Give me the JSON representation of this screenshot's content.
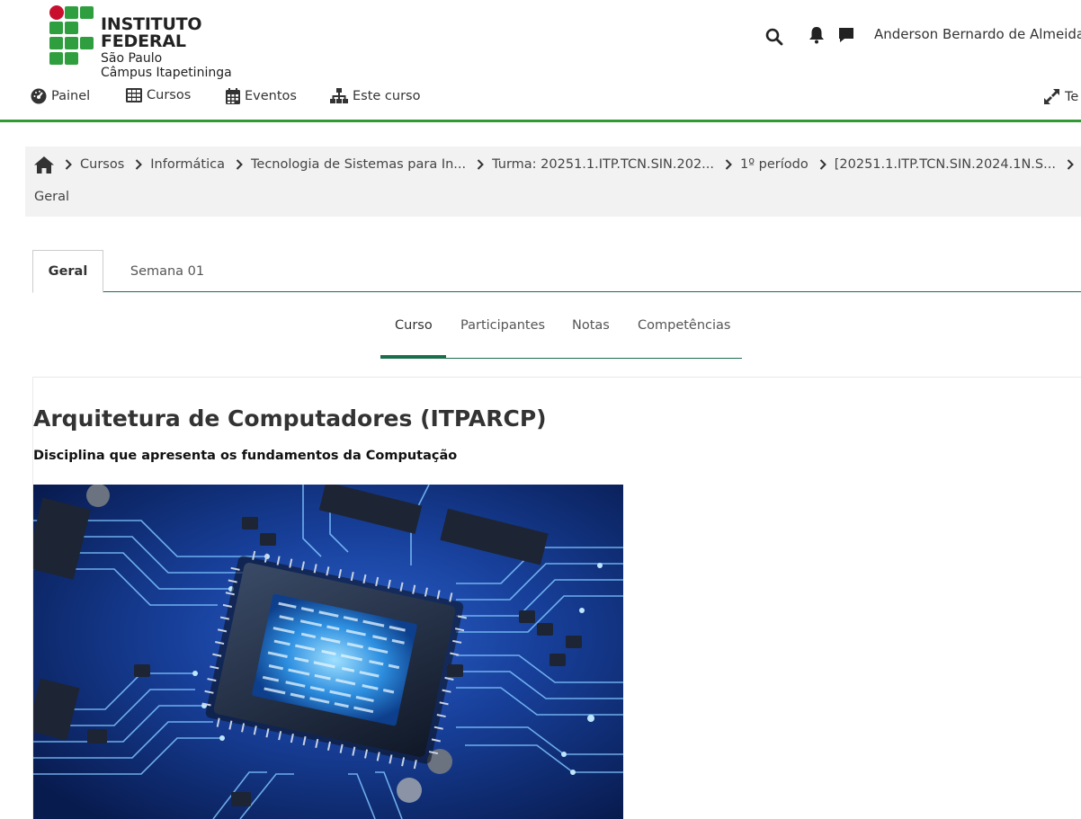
{
  "header": {
    "logo": {
      "title": "INSTITUTO FEDERAL",
      "line2": "São Paulo",
      "line3": "Câmpus Itapetininga"
    },
    "icons": [
      "search-icon",
      "bell-icon",
      "chat-icon"
    ],
    "user_name": "Anderson Bernardo de Almeida",
    "fullscreen_label": "Te"
  },
  "nav": {
    "items": [
      {
        "label": "Painel",
        "icon": "dashboard-icon"
      },
      {
        "label": "Cursos",
        "icon": "grid-icon"
      },
      {
        "label": "Eventos",
        "icon": "calendar-icon"
      },
      {
        "label": "Este curso",
        "icon": "sitemap-icon"
      }
    ]
  },
  "breadcrumb": {
    "home_icon": "home-icon",
    "items": [
      "Cursos",
      "Informática",
      "Tecnologia de Sistemas para In...",
      "Turma: 20251.1.ITP.TCN.SIN.202...",
      "1º período",
      "[20251.1.ITP.TCN.SIN.2024.1N.S..."
    ],
    "current": "Geral"
  },
  "section_tabs": [
    {
      "label": "Geral",
      "active": true
    },
    {
      "label": "Semana 01",
      "active": false
    }
  ],
  "course_nav": [
    {
      "label": "Curso",
      "active": true
    },
    {
      "label": "Participantes",
      "active": false
    },
    {
      "label": "Notas",
      "active": false
    },
    {
      "label": "Competências",
      "active": false
    }
  ],
  "course": {
    "title": "Arquitetura de Computadores (ITPARCP)",
    "subtitle": "Disciplina que apresenta os fundamentos da Computação"
  },
  "colors": {
    "brand_green": "#339933",
    "tab_green": "#1b6e4a",
    "logo_red": "#c8102e"
  }
}
